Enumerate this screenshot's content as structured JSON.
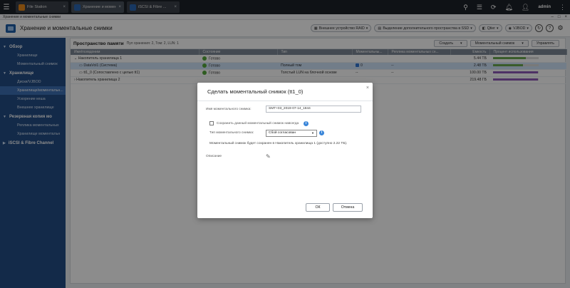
{
  "taskbar": {
    "tabs": [
      {
        "label": "File Station",
        "color": "#e8891b"
      },
      {
        "label": "Хранение и момен...",
        "color": "#2a66b3"
      },
      {
        "label": "iSCSI & Fibre ...",
        "color": "#2a66b3"
      }
    ],
    "user": "admin"
  },
  "window": {
    "title": "Хранение и моментальные снимки"
  },
  "app_header": {
    "title": "Хранение и моментальные снимки",
    "buttons": [
      "Внешнее устройство RAID",
      "Выделение дополнительного пространства в SSD",
      "Qtier",
      "VJBOD"
    ]
  },
  "sidebar": {
    "sections": [
      {
        "label": "Обзор",
        "items": [
          "Хранилище",
          "Моментальный снимок"
        ]
      },
      {
        "label": "Хранилище",
        "items": [
          "Диски/VJBOD",
          "Хранилище/моментальн...",
          "Ускорение кеша",
          "Внешнее хранилище"
        ]
      },
      {
        "label": "Резервная копия мо",
        "items": [
          "Реплика моментальных",
          "Хранилище моментальн"
        ]
      },
      {
        "label": "iSCSI & Fibre Channel",
        "items": []
      }
    ],
    "active_item": "Хранилище/моментальн..."
  },
  "main": {
    "title": "Пространство памяти",
    "subtitle": "Пул хранения: 2, Том: 2, LUN: 1",
    "actions": [
      "Создать",
      "Моментальный снимок",
      "Управлять"
    ],
    "columns": [
      "Имя/псевдоним",
      "Состояние",
      "Тип",
      "Моментальны...",
      "Реплика моментальных сн...",
      "Емкость",
      "Процент использования"
    ],
    "rows": [
      {
        "name": "Накопитель хранилища 1",
        "status": "Готово",
        "type": "",
        "snap": "",
        "replica": "",
        "capacity": "5.44 ТБ",
        "usage": 0.72,
        "bar_color": "#6aa84f"
      },
      {
        "name": "DataVol1 (Система)",
        "status": "Готово",
        "type": "Полный том",
        "snap": "0",
        "replica": "--",
        "capacity": "2.48 ТБ",
        "usage": 0.66,
        "bar_color": "#6aa84f"
      },
      {
        "name": "tt1_0 (Сопоставлено с целью tt1)",
        "status": "Готово",
        "type": "Толстый LUN на блочной основе",
        "snap": "--",
        "replica": "--",
        "capacity": "100.00 ТБ",
        "usage": 0.99,
        "bar_color": "#8e5ab8"
      },
      {
        "name": "Накопитель хранилища 2",
        "status": "",
        "type": "",
        "snap": "",
        "replica": "",
        "capacity": "219.48 ГБ",
        "usage": 0.99,
        "bar_color": "#8e5ab8"
      }
    ]
  },
  "dialog": {
    "title": "Сделать моментальный снимок (tt1_0)",
    "name_label": "Имя моментального снимка:",
    "name_value": "SMT+03_2019-07-14_1844",
    "keep_label": "Сохранить данный моментальный снимок навсегда",
    "type_label": "Тип моментального снимка:",
    "type_value": "Сбой согласован",
    "note": "Моментальный снимок будет сохранен в Накопитель хранилища 1 (доступно 2.22 ТБ).",
    "desc_label": "Описание",
    "ok": "ОК",
    "cancel": "Отмена"
  }
}
